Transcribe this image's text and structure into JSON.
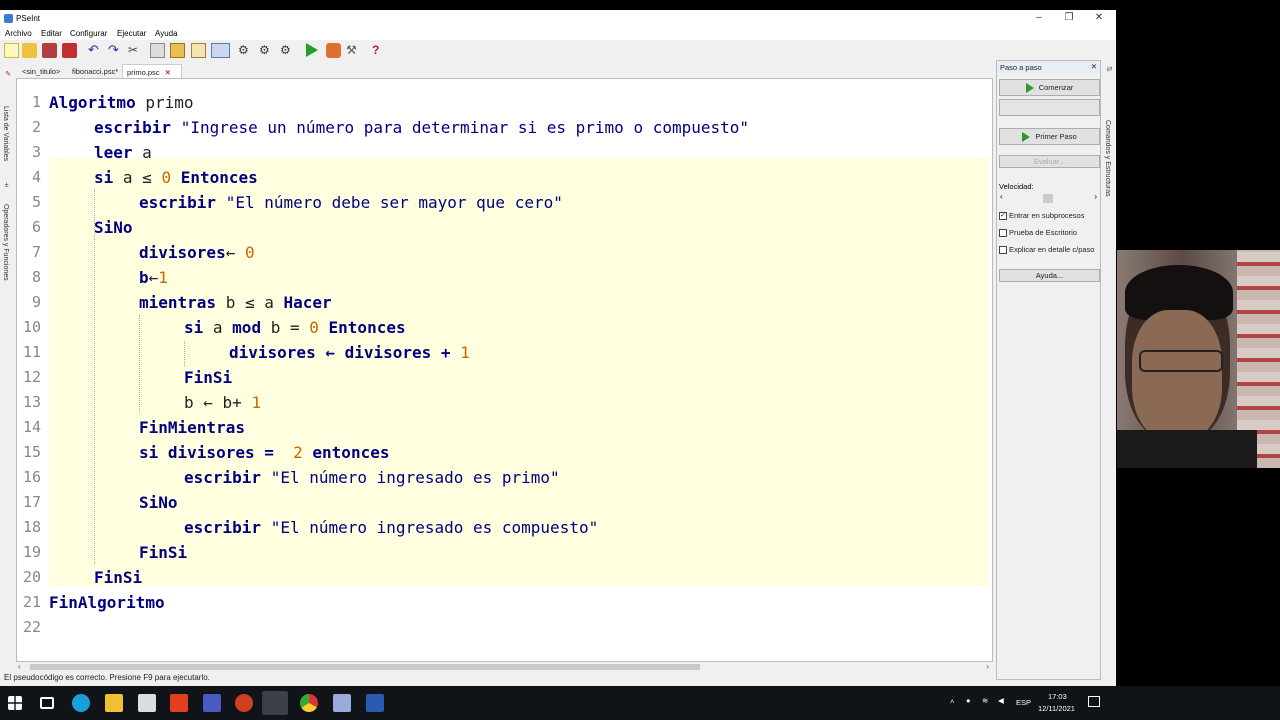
{
  "window": {
    "title": "PSeInt"
  },
  "menu": [
    "Archivo",
    "Editar",
    "Configurar",
    "Ejecutar",
    "Ayuda"
  ],
  "tabs": [
    {
      "label": "<sin_titulo>"
    },
    {
      "label": "fibonacci.psc*"
    },
    {
      "label": "primo.psc",
      "close": "✕"
    }
  ],
  "side_left": {
    "vars": "Lista de Variables",
    "ops": "Operadores y Funciones"
  },
  "side_right": {
    "commands": "Comandos y Estructuras"
  },
  "code_lines": [
    "1",
    "2",
    "3",
    "4",
    "5",
    "6",
    "7",
    "8",
    "9",
    "10",
    "11",
    "12",
    "13",
    "14",
    "15",
    "16",
    "17",
    "18",
    "19",
    "20",
    "21",
    "22"
  ],
  "code": {
    "l1": {
      "a": "Algoritmo",
      "b": " primo"
    },
    "l2": {
      "a": "escribir",
      "b": "\"Ingrese un número para determinar si es primo o compuesto\""
    },
    "l3": {
      "a": "leer",
      "b": " a"
    },
    "l4": {
      "a": "si",
      "b": " a ≤ ",
      "c": "0",
      "d": "Entonces"
    },
    "l5": {
      "a": "escribir",
      "b": "\"El número debe ser mayor que cero\""
    },
    "l6": {
      "a": "SiNo"
    },
    "l7": {
      "a": "divisores",
      "b": "← ",
      "c": "0"
    },
    "l8": {
      "a": "b",
      "b": "←",
      "c": "1"
    },
    "l9": {
      "a": "mientras",
      "b": " b ≤ a ",
      "c": "Hacer"
    },
    "l10": {
      "a": "si",
      "b": " a ",
      "c": "mod",
      "d": " b = ",
      "e": "0",
      "f": "Entonces"
    },
    "l11": {
      "a": "divisores ← divisores + ",
      "b": "1"
    },
    "l12": {
      "a": "FinSi"
    },
    "l13": {
      "a": "b ← b+ ",
      "b": "1"
    },
    "l14": {
      "a": "FinMientras"
    },
    "l15": {
      "a": "si",
      "b": " divisores =  ",
      "c": "2",
      "d": "entonces"
    },
    "l16": {
      "a": "escribir",
      "b": "\"El número ingresado es primo\""
    },
    "l17": {
      "a": "SiNo"
    },
    "l18": {
      "a": "escribir",
      "b": "\"El número ingresado es compuesto\""
    },
    "l19": {
      "a": "FinSi"
    },
    "l20": {
      "a": "FinSi"
    },
    "l21": {
      "a": "FinAlgoritmo"
    }
  },
  "status": "El pseudocódigo es correcto. Presione F9 para ejecutarlo.",
  "panel": {
    "title": "Paso a paso",
    "close": "✕",
    "start": "Comenzar",
    "first_step": "Primer Paso",
    "evaluate": "Evaluar...",
    "speed_label": "Velocidad:",
    "chk_subprocess": "Entrar en subprocesos",
    "chk_desk": "Prueba de Escritorio",
    "chk_explain": "Explicar en detalle c/paso",
    "help": "Ayuda...",
    "chk_subprocess_checked": true,
    "chk_desk_checked": false,
    "chk_explain_checked": false
  },
  "taskbar": {
    "lang": "ESP",
    "time": "17:03",
    "date": "12/11/2021"
  }
}
